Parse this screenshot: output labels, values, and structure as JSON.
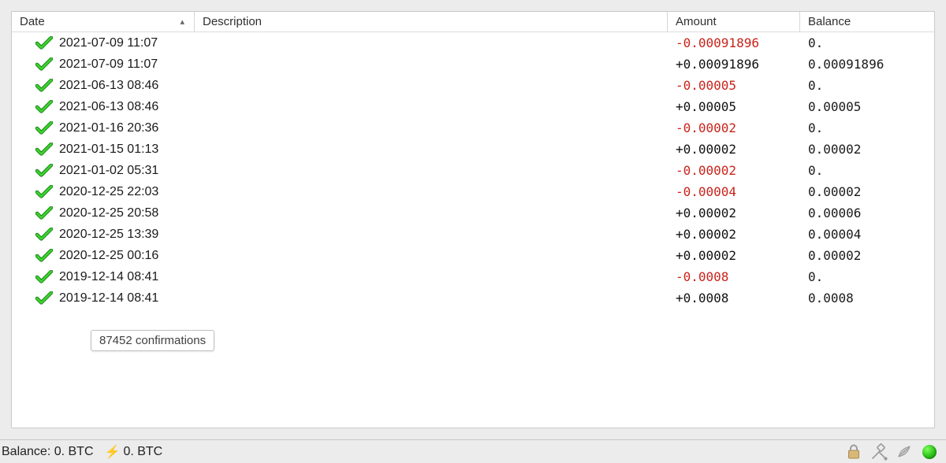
{
  "columns": {
    "date": "Date",
    "description": "Description",
    "amount": "Amount",
    "balance": "Balance",
    "sort_col": "date",
    "sort_dir_glyph": "▴"
  },
  "transactions": [
    {
      "icon": "check",
      "date": "2021-07-09 11:07",
      "desc": "",
      "amount": "-0.00091896",
      "amount_sign": "neg",
      "balance": "0."
    },
    {
      "icon": "check",
      "date": "2021-07-09 11:07",
      "desc": "",
      "amount": "+0.00091896",
      "amount_sign": "pos",
      "balance": "0.00091896"
    },
    {
      "icon": "check",
      "date": "2021-06-13 08:46",
      "desc": "",
      "amount": "-0.00005",
      "amount_sign": "neg",
      "balance": "0."
    },
    {
      "icon": "check",
      "date": "2021-06-13 08:46",
      "desc": "",
      "amount": "+0.00005",
      "amount_sign": "pos",
      "balance": "0.00005"
    },
    {
      "icon": "check",
      "date": "2021-01-16 20:36",
      "desc": "",
      "amount": "-0.00002",
      "amount_sign": "neg",
      "balance": "0."
    },
    {
      "icon": "check",
      "date": "2021-01-15 01:13",
      "desc": "",
      "amount": "+0.00002",
      "amount_sign": "pos",
      "balance": "0.00002"
    },
    {
      "icon": "check",
      "date": "2021-01-02 05:31",
      "desc": "",
      "amount": "-0.00002",
      "amount_sign": "neg",
      "balance": "0."
    },
    {
      "icon": "check",
      "date": "2020-12-25 22:03",
      "desc": "",
      "amount": "-0.00004",
      "amount_sign": "neg",
      "balance": "0.00002"
    },
    {
      "icon": "check",
      "date": "2020-12-25 20:58",
      "desc": "",
      "amount": "+0.00002",
      "amount_sign": "pos",
      "balance": "0.00006"
    },
    {
      "icon": "check",
      "date": "2020-12-25 13:39",
      "desc": "",
      "amount": "+0.00002",
      "amount_sign": "pos",
      "balance": "0.00004"
    },
    {
      "icon": "check",
      "date": "2020-12-25 00:16",
      "desc": "",
      "amount": "+0.00002",
      "amount_sign": "pos",
      "balance": "0.00002"
    },
    {
      "icon": "check",
      "date": "2019-12-14 08:41",
      "desc": "",
      "amount": "-0.0008",
      "amount_sign": "neg",
      "balance": "0."
    },
    {
      "icon": "check",
      "date": "2019-12-14 08:41",
      "desc": "",
      "amount": "+0.0008",
      "amount_sign": "pos",
      "balance": "0.0008"
    }
  ],
  "tooltip": "87452 confirmations",
  "statusbar": {
    "balance_label": "Balance:",
    "balance_value": "0. BTC",
    "lightning_glyph": "⚡",
    "lightning_value": "0. BTC"
  }
}
